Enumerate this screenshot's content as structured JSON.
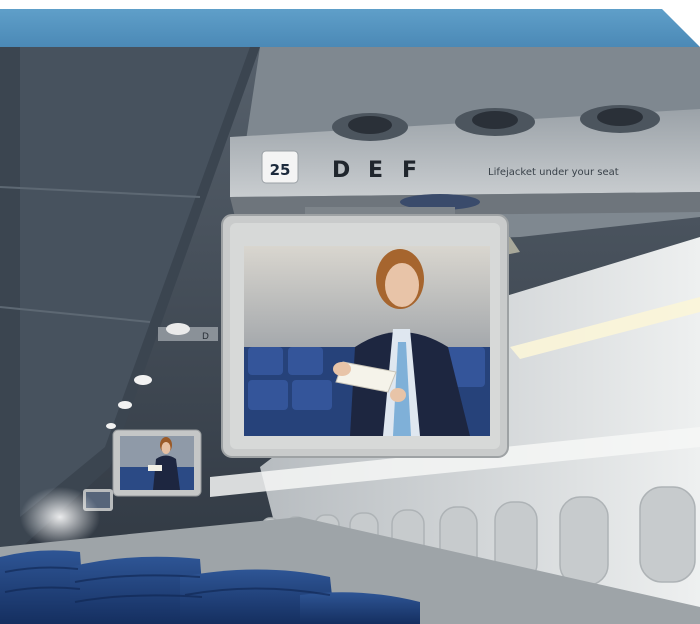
{
  "scene": {
    "row_number": "25",
    "seat_letters": [
      "D",
      "E",
      "F"
    ],
    "life_vest_text": "Lifejacket under your seat"
  },
  "colors": {
    "banner": "#4b89b6",
    "cabin_ceiling": "#4a5664",
    "cabin_wall": "#dde1e3",
    "seat_blue": "#1f3f7a",
    "screen_bezel": "#cfd2d2"
  },
  "icons": {
    "reading_light": "reading-light-icon",
    "air_vent": "air-vent-icon"
  }
}
